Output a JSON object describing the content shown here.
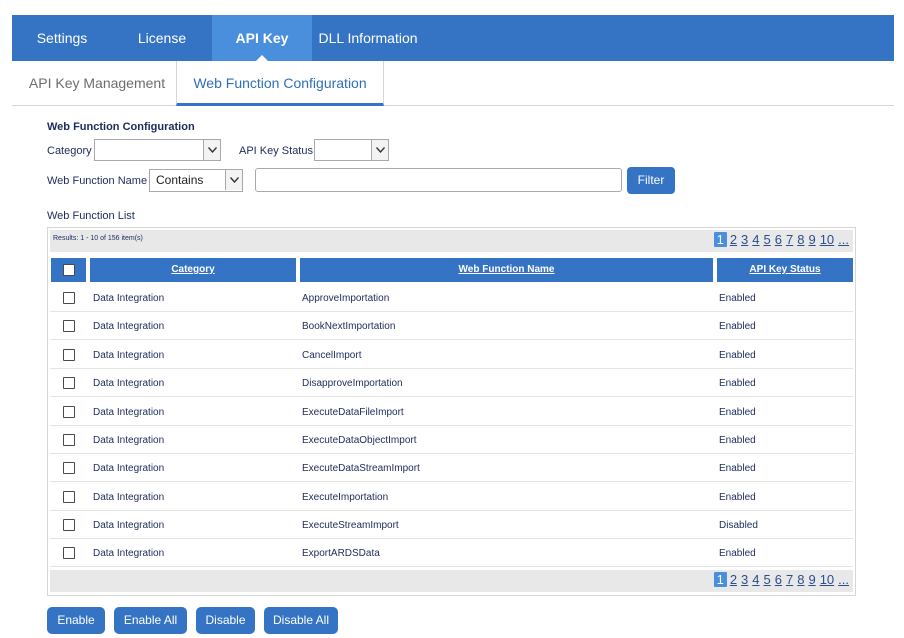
{
  "top_tabs": [
    {
      "label": "Settings",
      "active": false
    },
    {
      "label": "License",
      "active": false
    },
    {
      "label": "API Key",
      "active": true
    },
    {
      "label": "DLL Information",
      "active": false
    }
  ],
  "sub_tabs": [
    {
      "label": "API Key Management",
      "active": false
    },
    {
      "label": "Web Function Configuration",
      "active": true
    }
  ],
  "filters": {
    "heading": "Web Function Configuration",
    "category_label": "Category",
    "category_value": "",
    "status_label": "API Key Status",
    "status_value": "",
    "name_label": "Web Function Name",
    "name_operator": "Contains",
    "name_value": "",
    "filter_button": "Filter"
  },
  "list": {
    "title": "Web Function List",
    "results_text": "Results: 1 - 10 of 156 item(s)",
    "pages": [
      "1",
      "2",
      "3",
      "4",
      "5",
      "6",
      "7",
      "8",
      "9",
      "10",
      "..."
    ],
    "current_page": "1",
    "columns": [
      "Category",
      "Web Function Name",
      "API Key Status"
    ],
    "rows": [
      {
        "category": "Data Integration",
        "name": "ApproveImportation",
        "status": "Enabled"
      },
      {
        "category": "Data Integration",
        "name": "BookNextImportation",
        "status": "Enabled"
      },
      {
        "category": "Data Integration",
        "name": "CancelImport",
        "status": "Enabled"
      },
      {
        "category": "Data Integration",
        "name": "DisapproveImportation",
        "status": "Enabled"
      },
      {
        "category": "Data Integration",
        "name": "ExecuteDataFileImport",
        "status": "Enabled"
      },
      {
        "category": "Data Integration",
        "name": "ExecuteDataObjectImport",
        "status": "Enabled"
      },
      {
        "category": "Data Integration",
        "name": "ExecuteDataStreamImport",
        "status": "Enabled"
      },
      {
        "category": "Data Integration",
        "name": "ExecuteImportation",
        "status": "Enabled"
      },
      {
        "category": "Data Integration",
        "name": "ExecuteStreamImport",
        "status": "Disabled"
      },
      {
        "category": "Data Integration",
        "name": "ExportARDSData",
        "status": "Enabled"
      }
    ]
  },
  "actions": {
    "enable": "Enable",
    "enable_all": "Enable All",
    "disable": "Disable",
    "disable_all": "Disable All"
  },
  "colors": {
    "primary": "#3574c4",
    "active_tab": "#4a8fdc",
    "text": "#1c2b5a"
  },
  "icons": {
    "dropdown": "chevron-down-icon"
  }
}
